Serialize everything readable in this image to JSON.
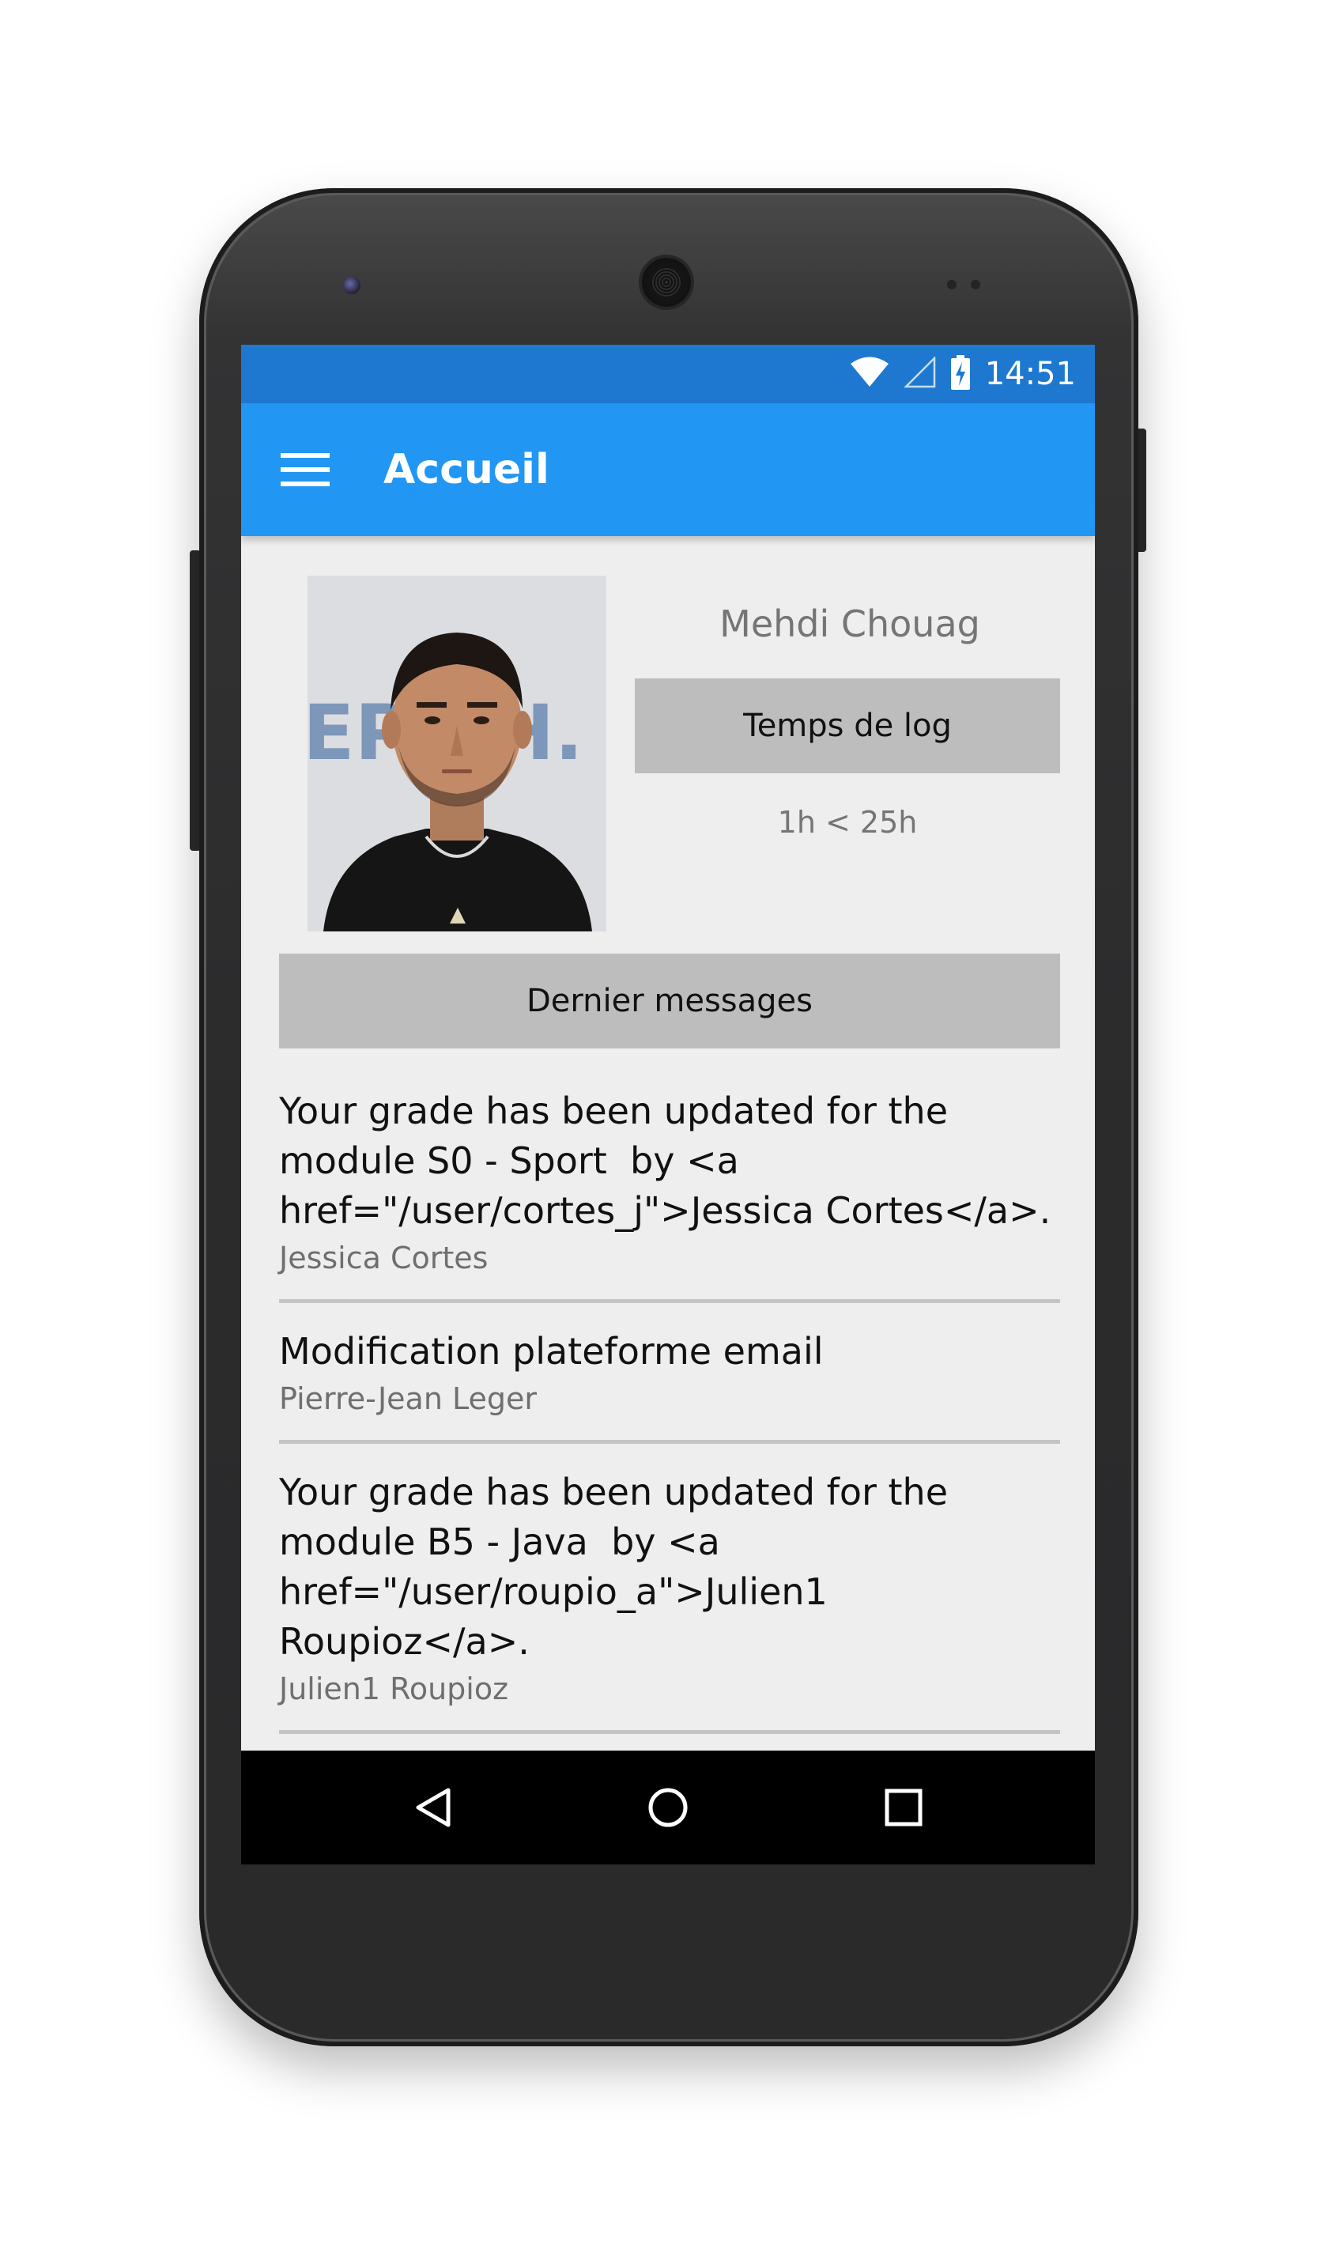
{
  "status_bar": {
    "time": "14:51",
    "icons": [
      "wifi-icon",
      "signal-icon",
      "battery-charging-icon"
    ]
  },
  "app_bar": {
    "title": "Accueil",
    "menu_icon": "menu-icon"
  },
  "profile": {
    "name": "Mehdi Chouag",
    "log_button_label": "Temps de log",
    "log_value": "1h < 25h"
  },
  "messages_section": {
    "button_label": "Dernier messages",
    "items": [
      {
        "text": "Your grade has been updated for the module S0 - Sport  by <a href=\"/user/cortes_j\">Jessica Cortes</a>.",
        "author": "Jessica Cortes"
      },
      {
        "text": "Modification plateforme email",
        "author": "Pierre-Jean Leger"
      },
      {
        "text": "Your grade has been updated for the module B5 - Java  by <a href=\"/user/roupio_a\">Julien1 Roupioz</a>.",
        "author": "Julien1 Roupioz"
      }
    ]
  },
  "nav_bar": {
    "icons": [
      "back-icon",
      "home-icon",
      "recents-icon"
    ]
  },
  "colors": {
    "status_bar": "#1e78cf",
    "app_bar": "#2196f3",
    "screen_bg": "#eeeeee",
    "button_grey": "#bdbdbd",
    "divider": "#c4c4c4"
  }
}
